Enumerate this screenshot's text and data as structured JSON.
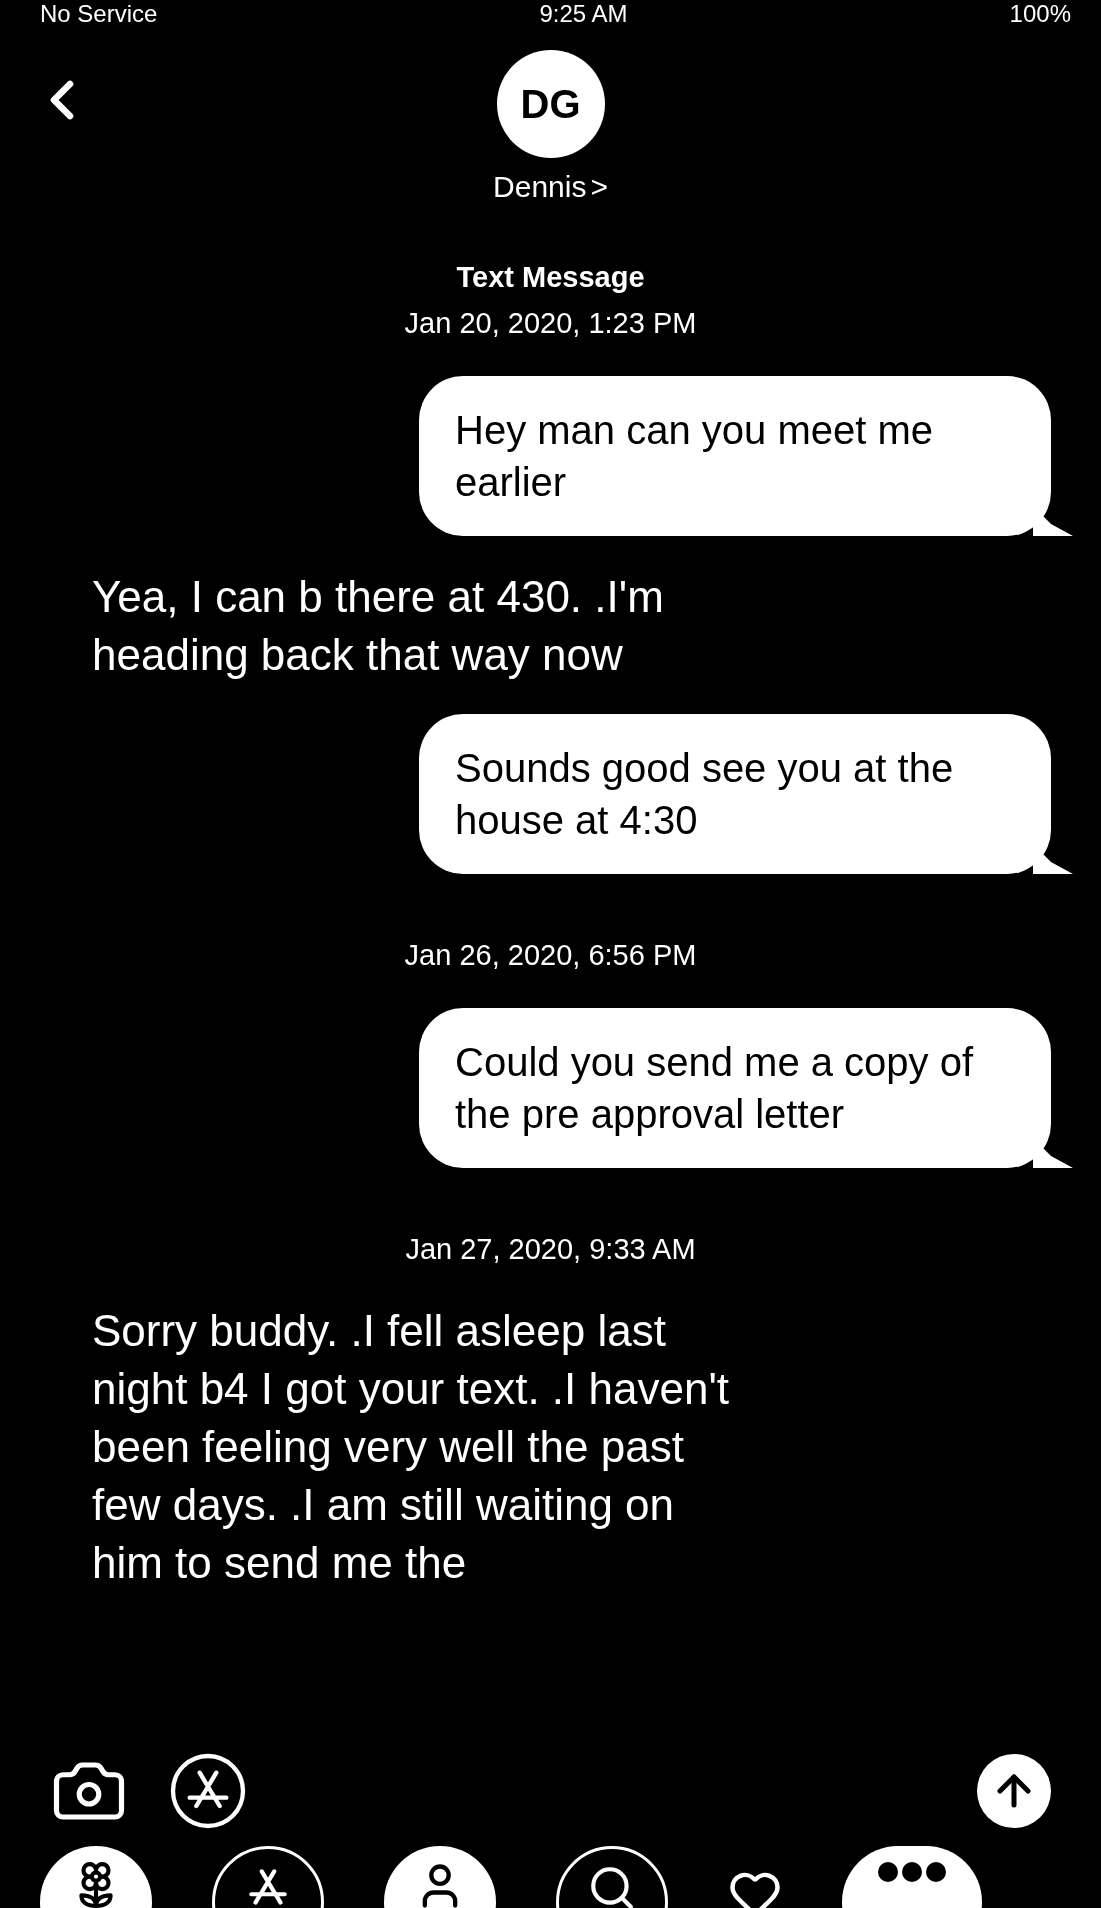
{
  "status_bar": {
    "carrier": "No Service",
    "time": "9:25 AM",
    "battery": "100%"
  },
  "header": {
    "initials": "DG",
    "name": "Dennis",
    "chevron": ">"
  },
  "thread": [
    {
      "kind": "stamp",
      "title": "Text Message",
      "date": "Jan 20, 2020, 1:23 PM"
    },
    {
      "kind": "sent",
      "text": "Hey man can you meet me earlier"
    },
    {
      "kind": "received",
      "text": "Yea,  I can b there at 430. .I'm heading back that way now"
    },
    {
      "kind": "sent",
      "text": "Sounds good see you at the house at 4:30"
    },
    {
      "kind": "stamp",
      "date": "Jan 26, 2020, 6:56 PM"
    },
    {
      "kind": "sent",
      "text": "Could you send me a copy of the pre approval letter"
    },
    {
      "kind": "stamp",
      "date": "Jan 27, 2020, 9:33 AM"
    },
    {
      "kind": "received",
      "text": "Sorry buddy. .I fell asleep last night b4 I got your text. .I haven't been feeling very well the past few days. .I am still waiting on him to send me the"
    }
  ],
  "app_drawer": [
    {
      "kind": "photos"
    },
    {
      "kind": "store"
    },
    {
      "kind": "people"
    },
    {
      "kind": "search"
    },
    {
      "kind": "heart"
    },
    {
      "kind": "more"
    }
  ]
}
